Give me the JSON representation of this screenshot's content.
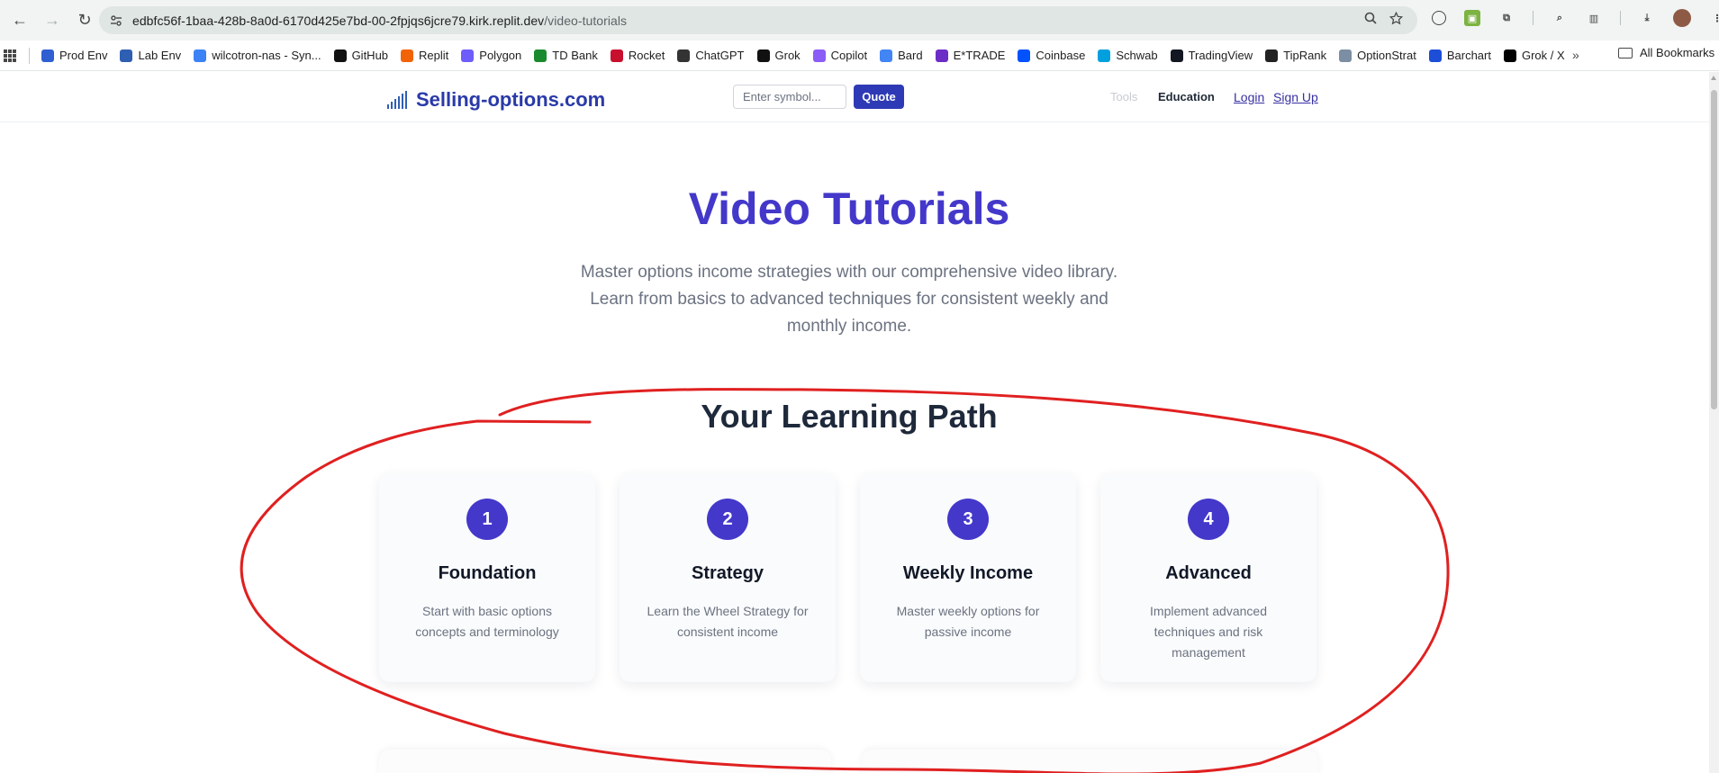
{
  "browser": {
    "url_host": "edbfc56f-1baa-428b-8a0d-6170d425e7bd-00-2fpjqs6jcre79.kirk.replit.dev",
    "url_path": "/video-tutorials",
    "bookmarks": [
      {
        "label": "Prod Env",
        "icon": "so-icon",
        "color": "#2f5fd1"
      },
      {
        "label": "Lab Env",
        "icon": "bars-icon",
        "color": "#2f5fb3"
      },
      {
        "label": "wilcotron-nas - Syn...",
        "icon": "dsm-icon",
        "color": "#3b82f6"
      },
      {
        "label": "GitHub",
        "icon": "github-icon",
        "color": "#111111"
      },
      {
        "label": "Replit",
        "icon": "replit-icon",
        "color": "#f26207"
      },
      {
        "label": "Polygon",
        "icon": "polygon-icon",
        "color": "#6d5dfc"
      },
      {
        "label": "TD Bank",
        "icon": "td-icon",
        "color": "#1a8a2e"
      },
      {
        "label": "Rocket",
        "icon": "rocket-icon",
        "color": "#c8102e"
      },
      {
        "label": "ChatGPT",
        "icon": "chatgpt-icon",
        "color": "#333333"
      },
      {
        "label": "Grok",
        "icon": "grok-icon",
        "color": "#111111"
      },
      {
        "label": "Copilot",
        "icon": "copilot-icon",
        "color": "#8b5cf6"
      },
      {
        "label": "Bard",
        "icon": "bard-icon",
        "color": "#4285f4"
      },
      {
        "label": "E*TRADE",
        "icon": "etrade-icon",
        "color": "#6c2dc7"
      },
      {
        "label": "Coinbase",
        "icon": "coinbase-icon",
        "color": "#0052ff"
      },
      {
        "label": "Schwab",
        "icon": "schwab-icon",
        "color": "#00a0df"
      },
      {
        "label": "TradingView",
        "icon": "tradingview-icon",
        "color": "#131722"
      },
      {
        "label": "TipRank",
        "icon": "tipranks-icon",
        "color": "#222222"
      },
      {
        "label": "OptionStrat",
        "icon": "optionstrat-icon",
        "color": "#7c8ea3"
      },
      {
        "label": "Barchart",
        "icon": "barchart-icon",
        "color": "#1d4ed8"
      },
      {
        "label": "Grok / X",
        "icon": "x-icon",
        "color": "#000000"
      }
    ],
    "more_label": "»",
    "all_bookmarks_label": "All Bookmarks"
  },
  "site": {
    "logo_text": "Selling-options.com",
    "symbol_placeholder": "Enter symbol...",
    "quote_label": "Quote",
    "nav": {
      "tools": "Tools",
      "education": "Education",
      "login": "Login",
      "signup": "Sign Up"
    }
  },
  "hero": {
    "title": "Video Tutorials",
    "subtitle": "Master options income strategies with our comprehensive video library. Learn from basics to advanced techniques for consistent weekly and monthly income."
  },
  "learning_path": {
    "title": "Your Learning Path",
    "steps": [
      {
        "number": "1",
        "title": "Foundation",
        "description": "Start with basic options concepts and terminology"
      },
      {
        "number": "2",
        "title": "Strategy",
        "description": "Learn the Wheel Strategy for consistent income"
      },
      {
        "number": "3",
        "title": "Weekly Income",
        "description": "Master weekly options for passive income"
      },
      {
        "number": "4",
        "title": "Advanced",
        "description": "Implement advanced techniques and risk management"
      }
    ]
  },
  "colors": {
    "accent": "#4338ca",
    "quote_button": "#2e3ab5",
    "annotation": "#e02020"
  }
}
